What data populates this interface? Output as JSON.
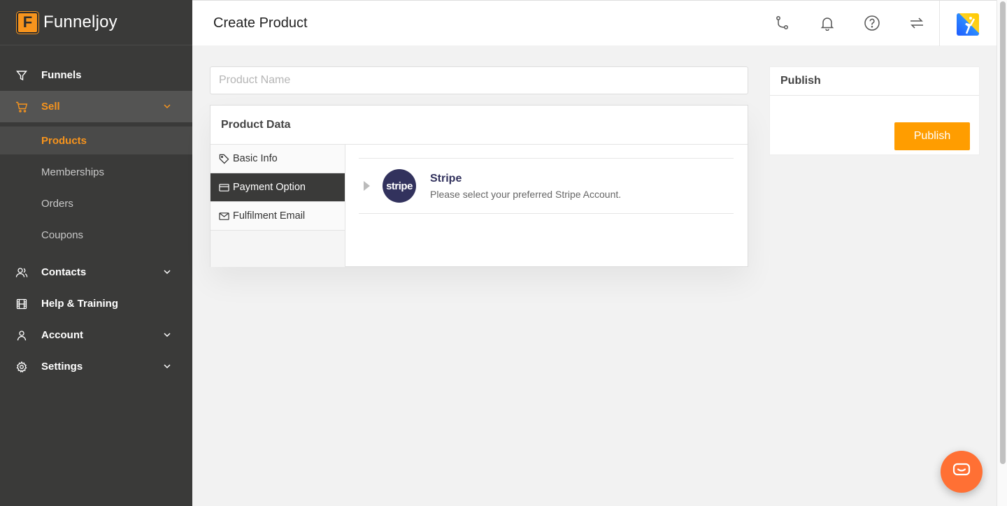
{
  "brand": {
    "logo_letter": "F",
    "name": "Funneljoy"
  },
  "sidebar": {
    "items": [
      {
        "label": "Funnels",
        "icon": "filter-icon"
      },
      {
        "label": "Sell",
        "icon": "cart-icon",
        "active": true,
        "expanded": true,
        "children": [
          {
            "label": "Products",
            "active": true
          },
          {
            "label": "Memberships"
          },
          {
            "label": "Orders"
          },
          {
            "label": "Coupons"
          }
        ]
      },
      {
        "label": "Contacts",
        "icon": "users-icon"
      },
      {
        "label": "Help & Training",
        "icon": "film-icon"
      },
      {
        "label": "Account",
        "icon": "user-icon"
      },
      {
        "label": "Settings",
        "icon": "gear-icon"
      }
    ]
  },
  "header": {
    "title": "Create Product",
    "icons": [
      "route-icon",
      "bell-icon",
      "help-icon",
      "sync-icon",
      "avatar"
    ]
  },
  "form": {
    "product_name_placeholder": "Product Name",
    "product_name_value": ""
  },
  "product_data": {
    "title": "Product Data",
    "tabs": [
      {
        "label": "Basic Info",
        "icon": "tag-icon"
      },
      {
        "label": "Payment Option",
        "icon": "credit-card-icon",
        "active": true
      },
      {
        "label": "Fulfilment Email",
        "icon": "mail-icon"
      }
    ],
    "payment": {
      "logo_text": "stripe",
      "title": "Stripe",
      "description": "Please select your preferred Stripe Account."
    }
  },
  "publish": {
    "title": "Publish",
    "button_label": "Publish"
  },
  "colors": {
    "accent": "#f7941d",
    "button": "#ff9d00",
    "sidebar": "#3a3a39",
    "stripe": "#32325d",
    "chat": "#ff7034"
  }
}
